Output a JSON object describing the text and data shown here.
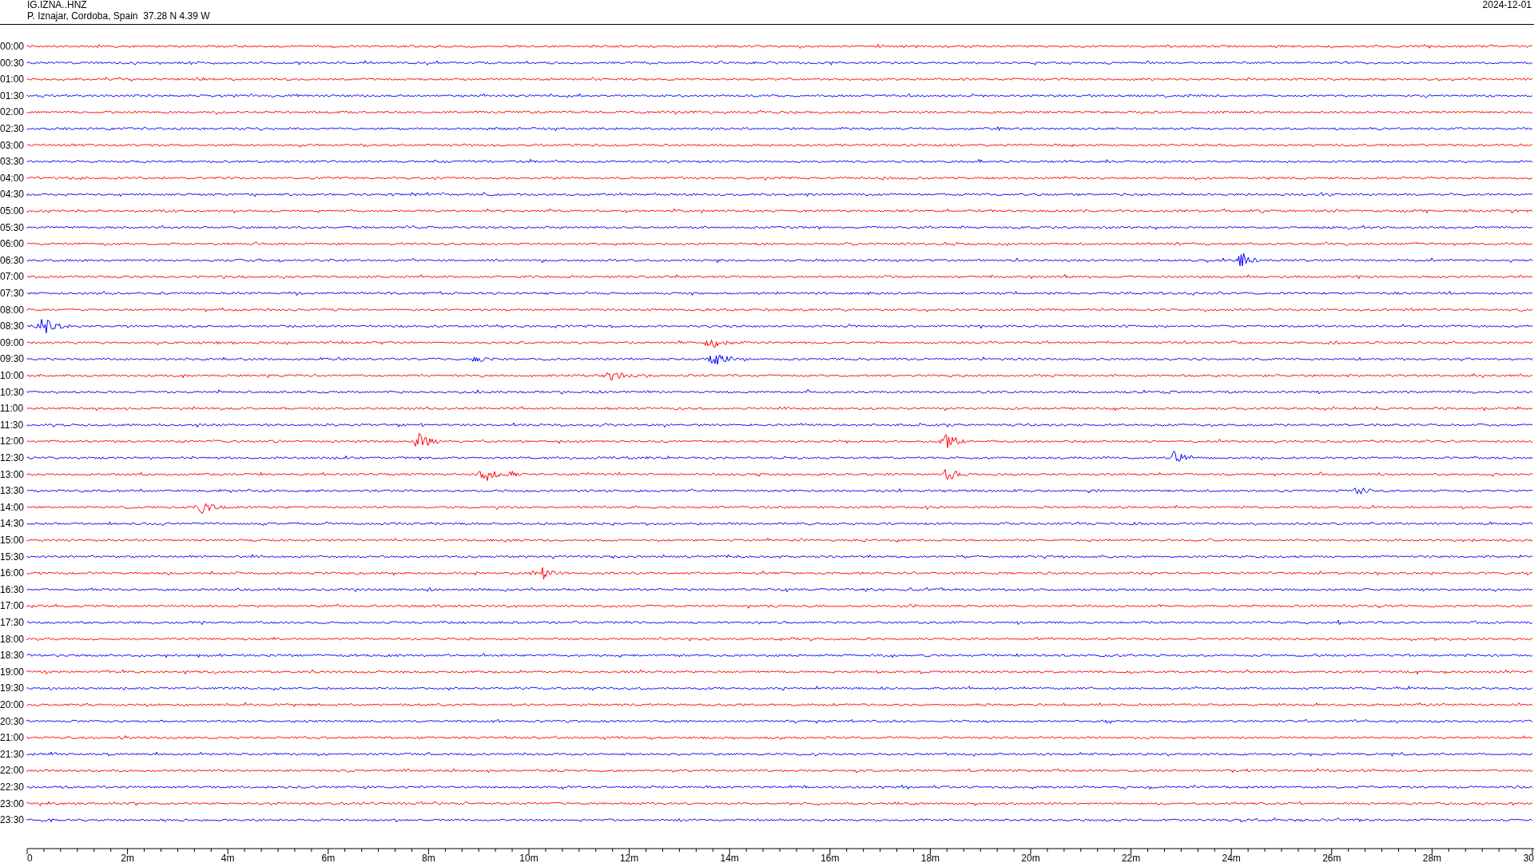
{
  "header": {
    "station": "IG.IZNA..HNZ",
    "location": "P. Iznajar, Cordoba, Spain  37.28 N 4.39 W",
    "date": "2024-12-01"
  },
  "rows": [
    {
      "time": "00:00",
      "color": "#ff0000"
    },
    {
      "time": "00:30",
      "color": "#0000ff"
    },
    {
      "time": "01:00",
      "color": "#ff0000"
    },
    {
      "time": "01:30",
      "color": "#0000ff"
    },
    {
      "time": "02:00",
      "color": "#ff0000"
    },
    {
      "time": "02:30",
      "color": "#0000ff"
    },
    {
      "time": "03:00",
      "color": "#ff0000"
    },
    {
      "time": "03:30",
      "color": "#0000ff"
    },
    {
      "time": "04:00",
      "color": "#ff0000"
    },
    {
      "time": "04:30",
      "color": "#0000ff"
    },
    {
      "time": "05:00",
      "color": "#ff0000"
    },
    {
      "time": "05:30",
      "color": "#0000ff"
    },
    {
      "time": "06:00",
      "color": "#ff0000"
    },
    {
      "time": "06:30",
      "color": "#0000ff"
    },
    {
      "time": "07:00",
      "color": "#ff0000"
    },
    {
      "time": "07:30",
      "color": "#0000ff"
    },
    {
      "time": "08:00",
      "color": "#ff0000"
    },
    {
      "time": "08:30",
      "color": "#0000ff"
    },
    {
      "time": "09:00",
      "color": "#ff0000"
    },
    {
      "time": "09:30",
      "color": "#0000ff"
    },
    {
      "time": "10:00",
      "color": "#ff0000"
    },
    {
      "time": "10:30",
      "color": "#0000ff"
    },
    {
      "time": "11:00",
      "color": "#ff0000"
    },
    {
      "time": "11:30",
      "color": "#0000ff"
    },
    {
      "time": "12:00",
      "color": "#ff0000"
    },
    {
      "time": "12:30",
      "color": "#0000ff"
    },
    {
      "time": "13:00",
      "color": "#ff0000"
    },
    {
      "time": "13:30",
      "color": "#0000ff"
    },
    {
      "time": "14:00",
      "color": "#ff0000"
    },
    {
      "time": "14:30",
      "color": "#0000ff"
    },
    {
      "time": "15:00",
      "color": "#ff0000"
    },
    {
      "time": "15:30",
      "color": "#0000ff"
    },
    {
      "time": "16:00",
      "color": "#ff0000"
    },
    {
      "time": "16:30",
      "color": "#0000ff"
    },
    {
      "time": "17:00",
      "color": "#ff0000"
    },
    {
      "time": "17:30",
      "color": "#0000ff"
    },
    {
      "time": "18:00",
      "color": "#ff0000"
    },
    {
      "time": "18:30",
      "color": "#0000ff"
    },
    {
      "time": "19:00",
      "color": "#ff0000"
    },
    {
      "time": "19:30",
      "color": "#0000ff"
    },
    {
      "time": "20:00",
      "color": "#ff0000"
    },
    {
      "time": "20:30",
      "color": "#0000ff"
    },
    {
      "time": "21:00",
      "color": "#ff0000"
    },
    {
      "time": "21:30",
      "color": "#0000ff"
    },
    {
      "time": "22:00",
      "color": "#ff0000"
    },
    {
      "time": "22:30",
      "color": "#0000ff"
    },
    {
      "time": "23:00",
      "color": "#ff0000"
    },
    {
      "time": "23:30",
      "color": "#0000ff"
    }
  ],
  "axis": {
    "labels": [
      "0",
      "2m",
      "4m",
      "6m",
      "8m",
      "10m",
      "12m",
      "14m",
      "16m",
      "18m",
      "20m",
      "22m",
      "24m",
      "26m",
      "28m",
      "30"
    ]
  }
}
